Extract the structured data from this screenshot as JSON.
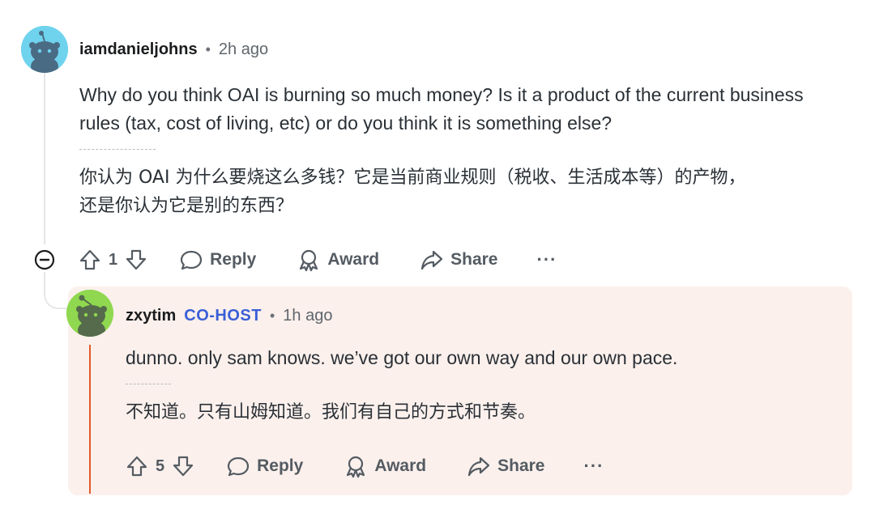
{
  "comments": [
    {
      "username": "iamdanieljohns",
      "separator": "•",
      "time": "2h ago",
      "body_en": "Why do you think OAI is burning so much money? Is it a product of the current business rules (tax, cost of living, etc) or do you think it is something else?",
      "body_zh_line1": "你认为 OAI 为什么要烧这么多钱？它是当前商业规则（税收、生活成本等）的产物，",
      "body_zh_line2": "还是你认为它是别的东西？",
      "votes": "1",
      "reply_label": "Reply",
      "award_label": "Award",
      "share_label": "Share",
      "more_label": "···",
      "avatar_color": "#6fd3ee"
    },
    {
      "username": "zxytim",
      "badge": "CO-HOST",
      "separator": "•",
      "time": "1h ago",
      "body_en": "dunno. only sam knows. we’ve got our own way and our own pace.",
      "body_zh": "不知道。只有山姆知道。我们有自己的方式和节奏。",
      "votes": "5",
      "reply_label": "Reply",
      "award_label": "Award",
      "share_label": "Share",
      "more_label": "···",
      "avatar_color": "#8fd84f"
    }
  ],
  "colors": {
    "cohost": "#3a5fd6",
    "reply_bg": "#fbf0ec",
    "accent": "#e45a2a"
  },
  "icons": [
    "collapse-icon",
    "upvote-icon",
    "downvote-icon",
    "reply-icon",
    "award-icon",
    "share-icon",
    "more-icon"
  ]
}
